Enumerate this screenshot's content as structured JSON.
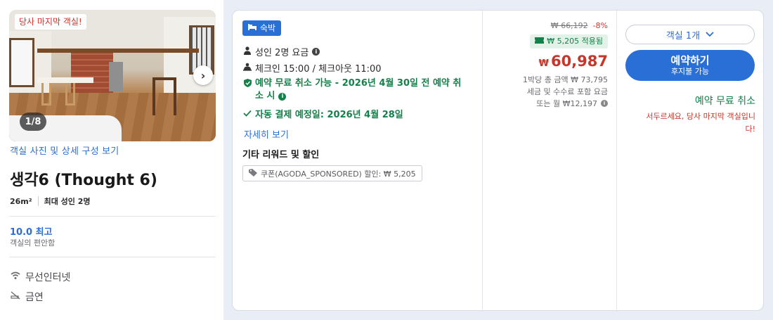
{
  "room": {
    "badge": "당사 마지막 객실!",
    "photo_counter": "1/8",
    "photo_link": "객실 사진 및 상세 구성 보기",
    "title": "생각6 (Thought 6)",
    "size": "26m²",
    "max_guests": "최대 성인 2명",
    "score": "10.0 최고",
    "score_label": "객실의 편안함",
    "amenities": [
      {
        "icon": "wifi-icon",
        "label": "무선인터넷"
      },
      {
        "icon": "no-smoking-icon",
        "label": "금연"
      }
    ]
  },
  "offer": {
    "tag": "숙박",
    "adult_rate": "성인 2명 요금",
    "checkin": "체크인 15:00 / 체크아웃 11:00",
    "free_cancel_line1": "예약 무료 취소 가능 - 2026년 4월 30일 전 예약 취",
    "free_cancel_line2": "소 시",
    "auto_pay": "자동 결제 예정일: 2026년 4월 28일",
    "details_link": "자세히 보기",
    "rewards_title": "기타 리워드 및 할인",
    "coupon": "쿠폰(AGODA_SPONSORED) 할인: ₩ 5,205"
  },
  "price": {
    "old": "₩ 66,192",
    "discount": "-8%",
    "applied": "₩ 5,205 적용됨",
    "currency": "₩",
    "current": "60,987",
    "per_night_total": "1박당 총 금액 ₩ 73,795",
    "taxes_note": "세금 및 수수료 포함 요금",
    "monthly": "또는 월 ₩12,197"
  },
  "booking": {
    "room_count": "객실 1개",
    "book_label": "예약하기",
    "pay_later": "후지불 가능",
    "free_cancel": "예약 무료 취소",
    "hurry_line1": "서두르세요, 당사 마지막 객실입니",
    "hurry_line2": "다!"
  },
  "colors": {
    "accent": "#2a6fd6",
    "price_red": "#c7362a",
    "green": "#14814a"
  }
}
